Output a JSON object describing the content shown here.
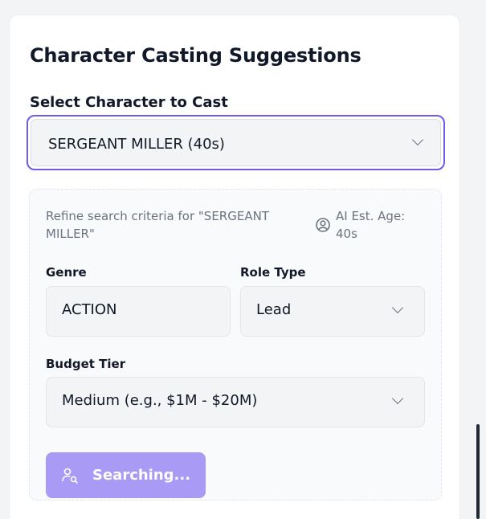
{
  "panel": {
    "title": "Character Casting Suggestions",
    "select_label": "Select Character to Cast",
    "selected_character": "SERGEANT MILLER (40s)"
  },
  "refine": {
    "text": "Refine search criteria for \"SERGEANT MILLER\"",
    "ai_age_text": "AI Est. Age: 40s",
    "icon": "user-circle-icon"
  },
  "fields": {
    "genre_label": "Genre",
    "genre_value": "ACTION",
    "role_type_label": "Role Type",
    "role_type_value": "Lead",
    "budget_label": "Budget Tier",
    "budget_value": "Medium (e.g., $1M - $20M)"
  },
  "search_button": {
    "label": "Searching...",
    "icon": "user-search-icon"
  },
  "colors": {
    "accent": "#6d5ce8",
    "button_disabled": "#a99af5",
    "muted_text": "#6b7280"
  }
}
